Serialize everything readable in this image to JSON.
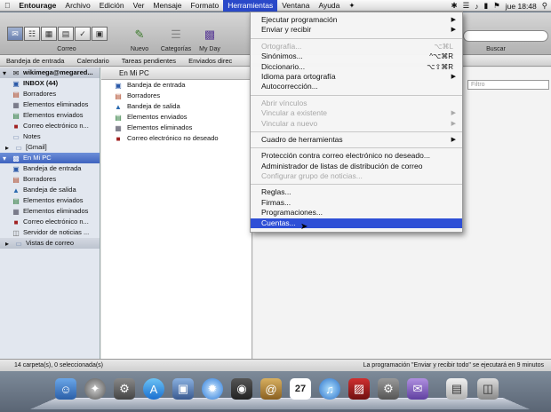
{
  "menubar": {
    "apple": "",
    "items": [
      "Entourage",
      "Archivo",
      "Edición",
      "Ver",
      "Mensaje",
      "Formato",
      "Herramientas",
      "Ventana",
      "Ayuda"
    ],
    "active_index": 6,
    "script_icon": "script-icon",
    "clock": "jue 18:48"
  },
  "toolbar": {
    "view_label": "Correo",
    "new_label": "Nuevo",
    "categories_label": "Categorías",
    "myday_label": "My Day",
    "search_label": "Buscar"
  },
  "tabs": [
    "Bandeja de entrada",
    "Calendario",
    "Tareas pendientes",
    "Enviados direc"
  ],
  "sidebar": {
    "account_header": "wikimega@megared...",
    "account_items": [
      {
        "label": "INBOX (44)",
        "bold": true,
        "icon": "inbox-icon"
      },
      {
        "label": "Borradores",
        "icon": "drafts-icon"
      },
      {
        "label": "Elementos eliminados",
        "icon": "trash-icon"
      },
      {
        "label": "Elementos enviados",
        "icon": "sent-icon"
      },
      {
        "label": "Correo electrónico n...",
        "icon": "junk-icon"
      },
      {
        "label": "Notes",
        "icon": "folder-icon"
      },
      {
        "label": "[Gmail]",
        "icon": "folder-icon"
      }
    ],
    "local_header": "En Mi PC",
    "local_items": [
      {
        "label": "Bandeja de entrada",
        "icon": "inbox-icon"
      },
      {
        "label": "Borradores",
        "icon": "drafts-icon"
      },
      {
        "label": "Bandeja de salida",
        "icon": "outbox-icon"
      },
      {
        "label": "Elementos enviados",
        "icon": "sent-icon"
      },
      {
        "label": "Elementos eliminados",
        "icon": "trash-icon"
      },
      {
        "label": "Correo electrónico n...",
        "icon": "junk-icon"
      },
      {
        "label": "Servidor de noticias ...",
        "icon": "news-server-icon"
      }
    ],
    "views_header": "Vistas de correo"
  },
  "middle": {
    "header": "En Mi PC",
    "items": [
      {
        "label": "Bandeja de entrada",
        "icon": "inbox-icon"
      },
      {
        "label": "Borradores",
        "icon": "drafts-icon"
      },
      {
        "label": "Bandeja de salida",
        "icon": "outbox-icon"
      },
      {
        "label": "Elementos enviados",
        "icon": "sent-icon"
      },
      {
        "label": "Elementos eliminados",
        "icon": "trash-icon"
      },
      {
        "label": "Correo electrónico no deseado",
        "icon": "junk-icon"
      }
    ]
  },
  "right": {
    "filter_placeholder": "Filtro"
  },
  "status": {
    "left": "14 carpeta(s), 0 seleccionada(s)",
    "right": "La programación \"Enviar y recibir todo\" se ejecutará en 9 minutos"
  },
  "menu": {
    "groups": [
      [
        {
          "label": "Ejecutar programación",
          "submenu": true
        },
        {
          "label": "Enviar y recibir",
          "submenu": true
        }
      ],
      [
        {
          "label": "Ortografía...",
          "shortcut": "⌥⌘L",
          "disabled": true
        },
        {
          "label": "Sinónimos...",
          "shortcut": "^⌥⌘R"
        },
        {
          "label": "Diccionario...",
          "shortcut": "⌥⇧⌘R"
        },
        {
          "label": "Idioma para ortografía",
          "submenu": true
        },
        {
          "label": "Autocorrección..."
        }
      ],
      [
        {
          "label": "Abrir vínculos",
          "disabled": true
        },
        {
          "label": "Vincular a existente",
          "submenu": true,
          "disabled": true
        },
        {
          "label": "Vincular a nuevo",
          "submenu": true,
          "disabled": true
        }
      ],
      [
        {
          "label": "Cuadro de herramientas",
          "submenu": true
        }
      ],
      [
        {
          "label": "Protección contra correo electrónico no deseado..."
        },
        {
          "label": "Administrador de listas de distribución de correo"
        },
        {
          "label": "Configurar grupo de noticias...",
          "disabled": true
        }
      ],
      [
        {
          "label": "Reglas..."
        },
        {
          "label": "Firmas..."
        },
        {
          "label": "Programaciones..."
        },
        {
          "label": "Cuentas...",
          "highlighted": true
        }
      ]
    ]
  },
  "dock": {
    "icons": [
      "finder-icon",
      "launchpad-icon",
      "system-preferences-icon",
      "app-store-icon",
      "preview-icon",
      "safari-icon",
      "facetime-icon",
      "mail-icon",
      "address-book-icon",
      "ical-icon",
      "itunes-icon",
      "photo-booth-icon",
      "system-preferences-icon",
      "entourage-icon",
      "documents-stack-icon",
      "trash-icon"
    ],
    "calendar_day": "27"
  }
}
